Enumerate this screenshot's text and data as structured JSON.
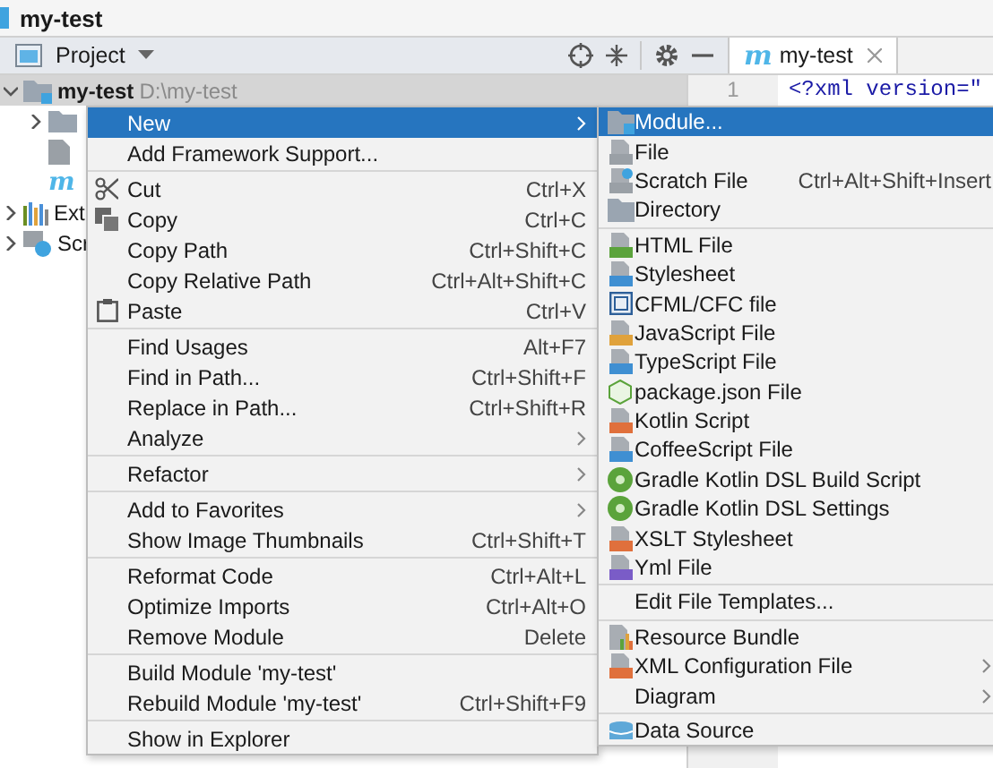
{
  "window": {
    "title": "my-test"
  },
  "panel": {
    "label": "Project"
  },
  "editor_tab": {
    "mark": "m",
    "label": "my-test",
    "selected": true
  },
  "editor": {
    "line_number": "1",
    "code": "<?xml version=\""
  },
  "tree": [
    {
      "label": "my-test",
      "path": "D:\\my-test",
      "kind": "module",
      "expanded": true,
      "selected": true,
      "children": [
        {
          "kind": "folder",
          "expanded": false,
          "selected": false
        },
        {
          "kind": "file",
          "selected": false
        },
        {
          "kind": "maven",
          "mark": "m",
          "selected": false
        }
      ]
    },
    {
      "label": "Ext",
      "kind": "libraries",
      "expanded": false,
      "selected": false
    },
    {
      "label": "Scr",
      "kind": "scratches",
      "expanded": false,
      "selected": false
    }
  ],
  "context_menu": {
    "groups": [
      [
        {
          "label": "New",
          "submenu": true,
          "selected": true
        },
        {
          "label": "Add Framework Support...",
          "selected": false
        }
      ],
      [
        {
          "label": "Cut",
          "shortcut": "Ctrl+X",
          "kind": "cut",
          "selected": false
        },
        {
          "label": "Copy",
          "shortcut": "Ctrl+C",
          "kind": "copy",
          "selected": false
        },
        {
          "label": "Copy Path",
          "shortcut": "Ctrl+Shift+C",
          "selected": false
        },
        {
          "label": "Copy Relative Path",
          "shortcut": "Ctrl+Alt+Shift+C",
          "selected": false
        },
        {
          "label": "Paste",
          "shortcut": "Ctrl+V",
          "kind": "paste",
          "selected": false
        }
      ],
      [
        {
          "label": "Find Usages",
          "shortcut": "Alt+F7",
          "selected": false
        },
        {
          "label": "Find in Path...",
          "shortcut": "Ctrl+Shift+F",
          "selected": false
        },
        {
          "label": "Replace in Path...",
          "shortcut": "Ctrl+Shift+R",
          "selected": false
        },
        {
          "label": "Analyze",
          "submenu": true,
          "selected": false
        }
      ],
      [
        {
          "label": "Refactor",
          "submenu": true,
          "selected": false
        }
      ],
      [
        {
          "label": "Add to Favorites",
          "submenu": true,
          "selected": false
        },
        {
          "label": "Show Image Thumbnails",
          "shortcut": "Ctrl+Shift+T",
          "selected": false
        }
      ],
      [
        {
          "label": "Reformat Code",
          "shortcut": "Ctrl+Alt+L",
          "selected": false
        },
        {
          "label": "Optimize Imports",
          "shortcut": "Ctrl+Alt+O",
          "selected": false
        },
        {
          "label": "Remove Module",
          "shortcut": "Delete",
          "selected": false
        }
      ],
      [
        {
          "label": "Build Module 'my-test'",
          "selected": false
        },
        {
          "label": "Rebuild Module 'my-test'",
          "shortcut": "Ctrl+Shift+F9",
          "selected": false
        }
      ],
      [
        {
          "label": "Show in Explorer",
          "selected": false
        }
      ]
    ]
  },
  "new_submenu": {
    "groups": [
      [
        {
          "label": "Module...",
          "kind": "module",
          "selected": true
        },
        {
          "label": "File",
          "kind": "file",
          "selected": false
        },
        {
          "label": "Scratch File",
          "shortcut": "Ctrl+Alt+Shift+Insert",
          "kind": "scratch",
          "selected": false
        },
        {
          "label": "Directory",
          "kind": "directory",
          "selected": false
        }
      ],
      [
        {
          "label": "HTML File",
          "kind": "html",
          "selected": false
        },
        {
          "label": "Stylesheet",
          "kind": "css",
          "selected": false
        },
        {
          "label": "CFML/CFC file",
          "kind": "cfml",
          "selected": false
        },
        {
          "label": "JavaScript File",
          "kind": "js",
          "selected": false
        },
        {
          "label": "TypeScript File",
          "kind": "ts",
          "selected": false
        },
        {
          "label": "package.json File",
          "kind": "npm",
          "selected": false
        },
        {
          "label": "Kotlin Script",
          "kind": "kotlin",
          "selected": false
        },
        {
          "label": "CoffeeScript File",
          "kind": "coffee",
          "selected": false
        },
        {
          "label": "Gradle Kotlin DSL Build Script",
          "kind": "gradle",
          "selected": false
        },
        {
          "label": "Gradle Kotlin DSL Settings",
          "kind": "gradle",
          "selected": false
        },
        {
          "label": "XSLT Stylesheet",
          "kind": "xslt",
          "selected": false
        },
        {
          "label": "Yml File",
          "kind": "yml",
          "selected": false
        }
      ],
      [
        {
          "label": "Edit File Templates...",
          "selected": false
        }
      ],
      [
        {
          "label": "Resource Bundle",
          "kind": "resource",
          "selected": false
        },
        {
          "label": "XML Configuration File",
          "kind": "xslt",
          "submenu": true,
          "selected": false
        },
        {
          "label": "Diagram",
          "submenu": true,
          "selected": false
        }
      ],
      [
        {
          "label": "Data Source",
          "kind": "database",
          "selected": false
        }
      ]
    ]
  }
}
